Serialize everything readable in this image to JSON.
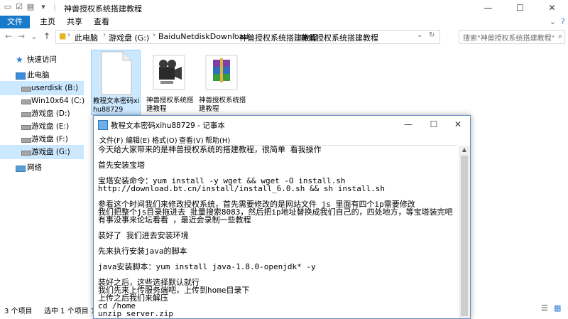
{
  "window": {
    "title": "神兽授权系统搭建教程",
    "minimize": "—",
    "maximize": "☐",
    "close": "✕"
  },
  "ribbon": {
    "tabs": [
      "文件",
      "主页",
      "共享",
      "查看"
    ]
  },
  "nav": {
    "back": "←",
    "forward": "→",
    "up_list": "⌄",
    "up": "↑",
    "breadcrumb": [
      "此电脑",
      "游戏盘 (G:)",
      "BaiduNetdiskDownload",
      "神兽授权系统搭建教程",
      "神兽授权系统搭建教程"
    ],
    "search_placeholder": "搜索\"神兽授权系统搭建教程\""
  },
  "sidebar": {
    "items": [
      {
        "label": "快速访问",
        "icon": "star-icon"
      },
      {
        "label": "此电脑",
        "icon": "pc-icon"
      },
      {
        "label": "userdisk (B:)",
        "icon": "drive-icon"
      },
      {
        "label": "Win10x64 (C:)",
        "icon": "drive-icon"
      },
      {
        "label": "游戏盘 (D:)",
        "icon": "drive-icon"
      },
      {
        "label": "游戏盘 (E:)",
        "icon": "drive-icon"
      },
      {
        "label": "游戏盘 (F:)",
        "icon": "drive-icon"
      },
      {
        "label": "游戏盘 (G:)",
        "icon": "drive-icon"
      },
      {
        "label": "网络",
        "icon": "network-icon"
      }
    ]
  },
  "files": [
    {
      "name": "教程文本密码xihu88729",
      "type": "text-file-icon"
    },
    {
      "name": "神兽授权系统搭建教程",
      "type": "video-file-icon"
    },
    {
      "name": "神兽授权系统搭建教程",
      "type": "rar-archive-icon"
    }
  ],
  "status": {
    "count": "3 个项目",
    "selected": "选中 1 个项目 1.44"
  },
  "notepad": {
    "title": "教程文本密码xihu88729 - 记事本",
    "menu": [
      "文件(F)",
      "编辑(E)",
      "格式(O)",
      "查看(V)",
      "帮助(H)"
    ],
    "lines": [
      "今天给大家带来的是神兽授权系统的搭建教程，很简单 看我操作",
      "",
      "首先安装宝塔",
      "",
      "宝塔安装命令：yum install -y wget && wget -O install.sh",
      "http://download.bt.cn/install/install_6.0.sh && sh install.sh",
      "",
      "参看这个时间我们来修改授权系统，首先需要修改的是网站文件 js 里面有四个ip需要修改",
      "我们把整个js目录拖进去 批量搜索8083，然后把ip地址替换成我们自己的，四处地方，等宝塔装完吧",
      "有事没事来论坛看看 ，最近会录制一些教程",
      "",
      "装好了 我们进去安装环境",
      "",
      "先来执行安装java的脚本",
      "",
      "java安装脚本：yum install java-1.8.0-openjdk* -y",
      "",
      "装好之后，这些选择默认就行",
      "我们先来上传服务端吧，上传到home目录下",
      "上传之后我们来解压",
      "cd /home",
      "unzip server.zip"
    ]
  }
}
